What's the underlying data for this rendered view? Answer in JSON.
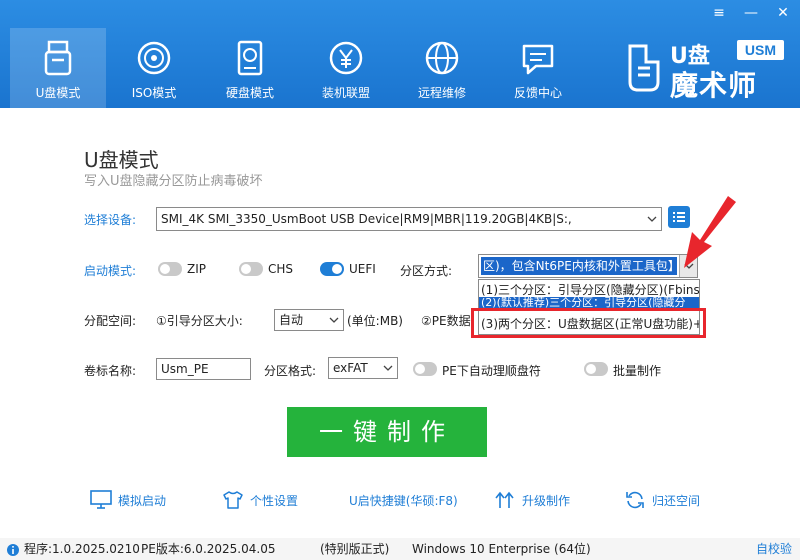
{
  "window": {
    "minimize_glyph": "—",
    "restore_glyph": "≡",
    "close_glyph": "✕"
  },
  "nav": {
    "items": [
      {
        "label": "U盘模式",
        "icon": "usb-drive-icon",
        "active": true
      },
      {
        "label": "ISO模式",
        "icon": "disc-icon"
      },
      {
        "label": "硬盘模式",
        "icon": "hard-disk-icon"
      },
      {
        "label": "装机联盟",
        "icon": "yen-coin-icon"
      },
      {
        "label": "远程维修",
        "icon": "globe-icon"
      },
      {
        "label": "反馈中心",
        "icon": "chat-bubble-icon"
      }
    ]
  },
  "brand": {
    "u": "U盘",
    "badge": "USM",
    "name": "魔术师"
  },
  "main": {
    "title": "U盘模式",
    "subtitle": "写入U盘隐藏分区防止病毒破坏"
  },
  "form": {
    "device_label": "选择设备:",
    "device_value": "SMI_4K SMI_3350_UsmBoot USB Device|RM9|MBR|119.20GB|4KB|S:,",
    "boot_label": "启动模式:",
    "boot_options": [
      {
        "label": "ZIP",
        "on": false
      },
      {
        "label": "CHS",
        "on": false
      },
      {
        "label": "UEFI",
        "on": true
      }
    ],
    "partition_method_label": "分区方式:",
    "partition_method_value": "区)，包含Nt6PE内核和外置工具包】",
    "partition_options": [
      "(1)三个分区：引导分区(隐藏分区)(Fbinst",
      "(2)(默认推荐)三个分区：引导分区(隐藏分",
      "(3)两个分区：U盘数据区(正常U盘功能)+"
    ],
    "alloc_label": "分配空间:",
    "boot_size_label": "①引导分区大小:",
    "boot_size_value": "自动",
    "unit": "(单位:MB)",
    "pe_size_label": "②PE数据",
    "volume_label": "卷标名称:",
    "volume_value": "Usm_PE",
    "format_label": "分区格式:",
    "format_value": "exFAT",
    "auto_letter_label": "PE下自动理顺盘符",
    "batch_label": "批量制作",
    "make_button": "一键制作"
  },
  "tools": [
    {
      "label": "模拟启动",
      "icon": "monitor-icon"
    },
    {
      "label": "个性设置",
      "icon": "shirt-icon"
    },
    {
      "label": "U启快捷键(华硕:F8)",
      "icon": null
    },
    {
      "label": "升级制作",
      "icon": "upgrade-arrows-icon"
    },
    {
      "label": "归还空间",
      "icon": "refresh-icon"
    }
  ],
  "status": {
    "program": "程序:1.0.2025.0210",
    "pe_version": "PE版本:6.0.2025.04.05",
    "edition": "(特别版正式)",
    "os": "Windows 10 Enterprise (64位)",
    "verify": "自校验"
  },
  "colors": {
    "accent": "#1f7ed6",
    "make_button": "#25b33c",
    "highlight": "#e8262d"
  }
}
